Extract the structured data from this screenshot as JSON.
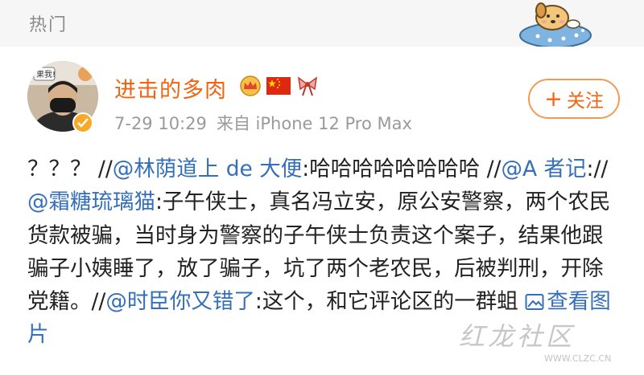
{
  "header": {
    "section_title": "热门",
    "sticker_icon": "cartoon-dog-sticker-icon"
  },
  "post": {
    "author": {
      "name": "进击的多肉",
      "avatar_icon": "user-avatar",
      "avatar_sign_text": "果我!",
      "verified_icon": "verified-badge-icon",
      "name_color": "#f3630f",
      "badges": [
        "crown-icon",
        "china-flag-icon",
        "bow-icon"
      ]
    },
    "time": "7-29 10:29",
    "source": "来自 iPhone 12 Pro Max",
    "follow_label": "关注",
    "content": {
      "seg1": "？？？ //",
      "mention1": "@林荫道上 de 大便",
      "seg2": ":哈哈哈哈哈哈哈哈 //",
      "mention2": "@A 者记",
      "seg3": "://",
      "mention3": "@霜糖琉璃猫",
      "seg4": ":子午侠士，真名冯立安，原公安警察，两个农民货款被骗，当时身为警察的子午侠士负责这个案子，结果他跟骗子小姨睡了，放了骗子，坑了两个老农民，后被判刑，开除党籍。//",
      "mention4": "@时臣你又错了",
      "seg5": ":这个，和它评论区的一群蛆 ",
      "view_image_label": "查看图片",
      "link_color": "#356fba"
    }
  },
  "watermark": {
    "text": "红龙社区",
    "url": "WWW.CLZC.CN"
  }
}
